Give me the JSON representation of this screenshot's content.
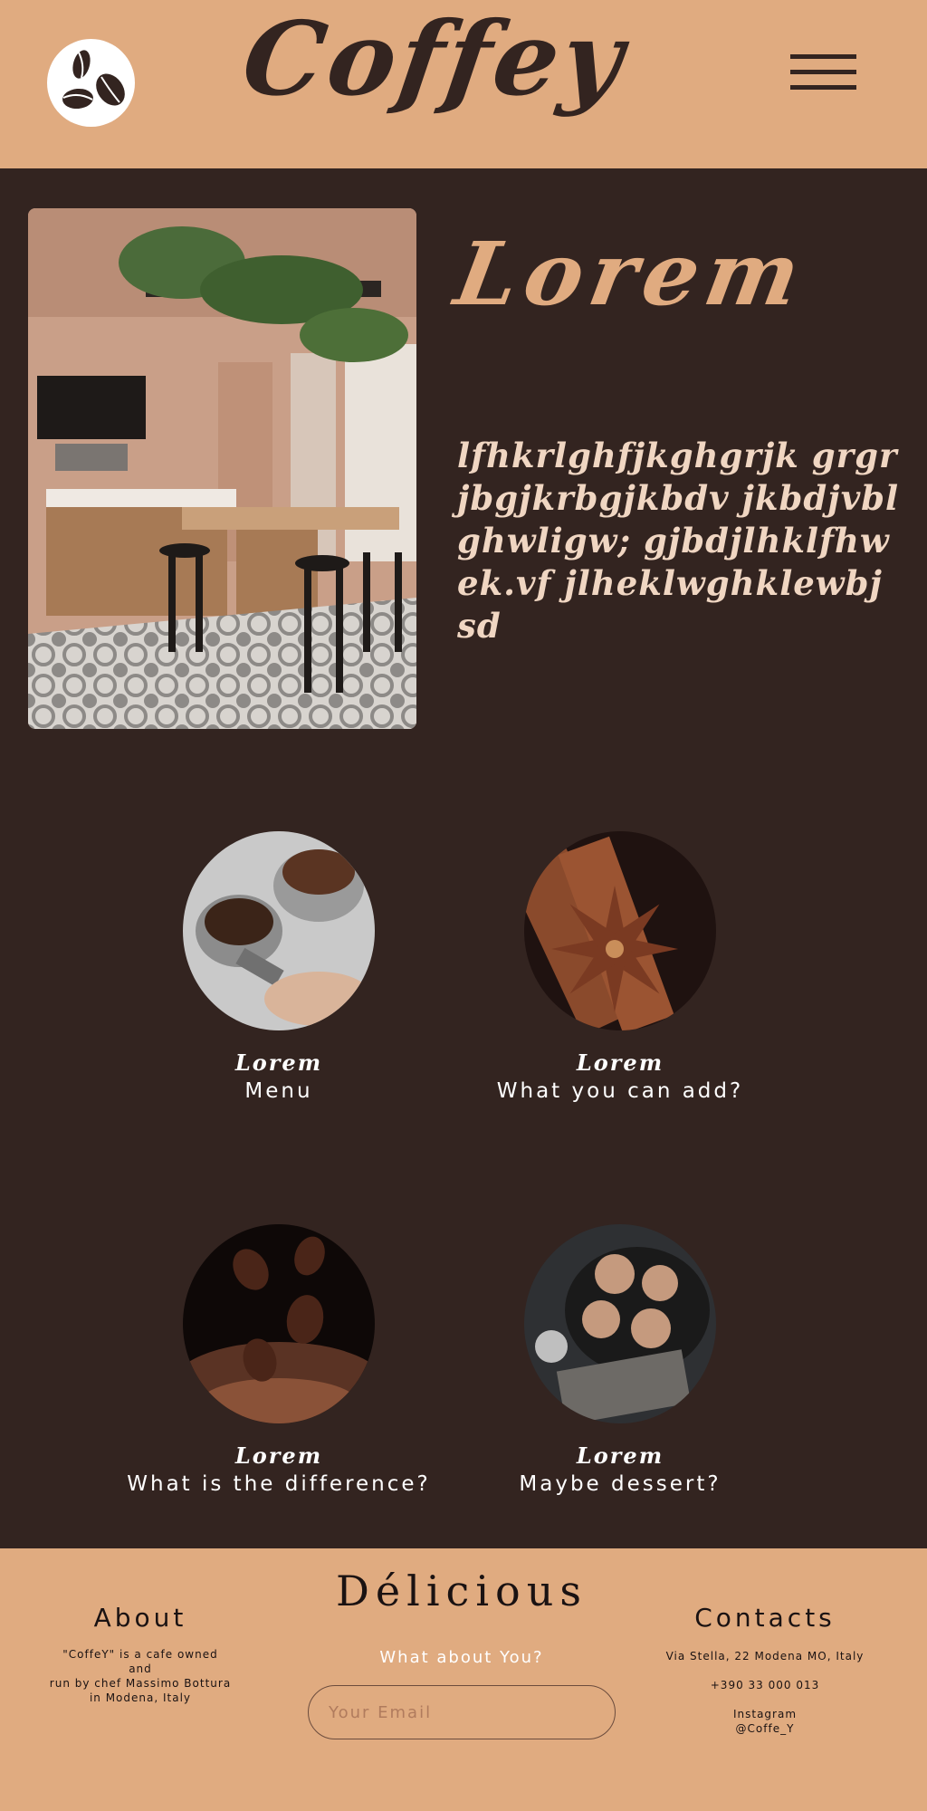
{
  "header": {
    "brand": "Coffey",
    "logo_icon": "coffee-beans-icon",
    "menu_icon": "hamburger-menu-icon"
  },
  "hero": {
    "title": "Lorem",
    "text": "lfhkrlghfjkghgrjk grgrjbgjkrbgjkbdv jkbdjvblghwligw; gjbdjlhklfhwek.vf jlheklwghklewbj sd",
    "image": "cafe-interior-photo"
  },
  "cards": [
    {
      "label": "Lorem",
      "caption": "Menu",
      "image": "espresso-portafilters-photo"
    },
    {
      "label": "Lorem",
      "caption": "What you can add?",
      "image": "cinnamon-star-anise-photo"
    },
    {
      "label": "Lorem",
      "caption": "What is the difference?",
      "image": "coffee-beans-photo"
    },
    {
      "label": "Lorem",
      "caption": "Maybe dessert?",
      "image": "cinnamon-rolls-photo"
    }
  ],
  "footer": {
    "title": "Délicious",
    "about": {
      "heading": "About",
      "line1": "\"CoffeY\" is a cafe owned",
      "line2": "and",
      "line3": "run by chef Massimo Bottura",
      "line4": "in Modena, Italy"
    },
    "question": "What about You?",
    "email_placeholder": "Your Email",
    "contacts": {
      "heading": "Contacts",
      "address": "Via Stella, 22 Modena MO, Italy",
      "phone": "+390 33 000 013",
      "instagram_label": "Instagram",
      "instagram_handle": "@Coffe_Y"
    }
  },
  "colors": {
    "accent": "#e0ab80",
    "background": "#332420",
    "text_light": "#ffffff"
  }
}
